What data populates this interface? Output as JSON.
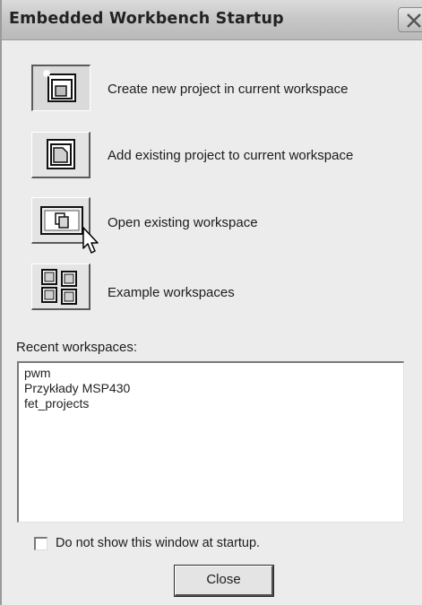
{
  "window": {
    "title": "Embedded Workbench Startup"
  },
  "actions": [
    {
      "label": "Create new project in current workspace",
      "icon": "new-project-icon"
    },
    {
      "label": "Add existing project to current workspace",
      "icon": "add-project-icon"
    },
    {
      "label": "Open existing workspace",
      "icon": "open-workspace-icon"
    },
    {
      "label": "Example workspaces",
      "icon": "example-workspaces-icon"
    }
  ],
  "recent": {
    "label": "Recent workspaces:",
    "items": [
      "pwm",
      "Przykłady MSP430",
      "fet_projects"
    ]
  },
  "options": {
    "no_show_label": "Do not show this window at startup.",
    "no_show_checked": false
  },
  "buttons": {
    "close_label": "Close"
  }
}
